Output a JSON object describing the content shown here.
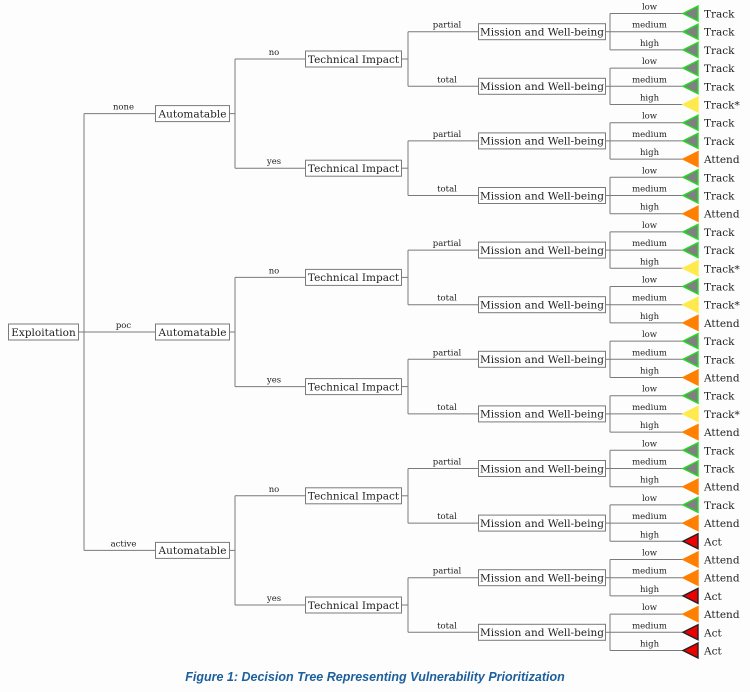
{
  "caption": "Figure 1: Decision Tree Representing Vulnerability Prioritization",
  "colors": {
    "line": "#7a7a7a",
    "Track": "#808080",
    "Track*": "#ffea4d",
    "Attend": "#ff8000",
    "Act": "#ee0000",
    "track_border": "#22dd22",
    "act_border": "#222222"
  },
  "tree": {
    "label": "Exploitation",
    "children": [
      {
        "edge": "none",
        "label": "Automatable",
        "children": [
          {
            "edge": "no",
            "label": "Technical Impact",
            "children": [
              {
                "edge": "partial",
                "label": "Mission and Well-being",
                "children": [
                  {
                    "edge": "low",
                    "leaf": "Track"
                  },
                  {
                    "edge": "medium",
                    "leaf": "Track"
                  },
                  {
                    "edge": "high",
                    "leaf": "Track"
                  }
                ]
              },
              {
                "edge": "total",
                "label": "Mission and Well-being",
                "children": [
                  {
                    "edge": "low",
                    "leaf": "Track"
                  },
                  {
                    "edge": "medium",
                    "leaf": "Track"
                  },
                  {
                    "edge": "high",
                    "leaf": "Track*"
                  }
                ]
              }
            ]
          },
          {
            "edge": "yes",
            "label": "Technical Impact",
            "children": [
              {
                "edge": "partial",
                "label": "Mission and Well-being",
                "children": [
                  {
                    "edge": "low",
                    "leaf": "Track"
                  },
                  {
                    "edge": "medium",
                    "leaf": "Track"
                  },
                  {
                    "edge": "high",
                    "leaf": "Attend"
                  }
                ]
              },
              {
                "edge": "total",
                "label": "Mission and Well-being",
                "children": [
                  {
                    "edge": "low",
                    "leaf": "Track"
                  },
                  {
                    "edge": "medium",
                    "leaf": "Track"
                  },
                  {
                    "edge": "high",
                    "leaf": "Attend"
                  }
                ]
              }
            ]
          }
        ]
      },
      {
        "edge": "poc",
        "label": "Automatable",
        "children": [
          {
            "edge": "no",
            "label": "Technical Impact",
            "children": [
              {
                "edge": "partial",
                "label": "Mission and Well-being",
                "children": [
                  {
                    "edge": "low",
                    "leaf": "Track"
                  },
                  {
                    "edge": "medium",
                    "leaf": "Track"
                  },
                  {
                    "edge": "high",
                    "leaf": "Track*"
                  }
                ]
              },
              {
                "edge": "total",
                "label": "Mission and Well-being",
                "children": [
                  {
                    "edge": "low",
                    "leaf": "Track"
                  },
                  {
                    "edge": "medium",
                    "leaf": "Track*"
                  },
                  {
                    "edge": "high",
                    "leaf": "Attend"
                  }
                ]
              }
            ]
          },
          {
            "edge": "yes",
            "label": "Technical Impact",
            "children": [
              {
                "edge": "partial",
                "label": "Mission and Well-being",
                "children": [
                  {
                    "edge": "low",
                    "leaf": "Track"
                  },
                  {
                    "edge": "medium",
                    "leaf": "Track"
                  },
                  {
                    "edge": "high",
                    "leaf": "Attend"
                  }
                ]
              },
              {
                "edge": "total",
                "label": "Mission and Well-being",
                "children": [
                  {
                    "edge": "low",
                    "leaf": "Track"
                  },
                  {
                    "edge": "medium",
                    "leaf": "Track*"
                  },
                  {
                    "edge": "high",
                    "leaf": "Attend"
                  }
                ]
              }
            ]
          }
        ]
      },
      {
        "edge": "active",
        "label": "Automatable",
        "children": [
          {
            "edge": "no",
            "label": "Technical Impact",
            "children": [
              {
                "edge": "partial",
                "label": "Mission and Well-being",
                "children": [
                  {
                    "edge": "low",
                    "leaf": "Track"
                  },
                  {
                    "edge": "medium",
                    "leaf": "Track"
                  },
                  {
                    "edge": "high",
                    "leaf": "Attend"
                  }
                ]
              },
              {
                "edge": "total",
                "label": "Mission and Well-being",
                "children": [
                  {
                    "edge": "low",
                    "leaf": "Track"
                  },
                  {
                    "edge": "medium",
                    "leaf": "Attend"
                  },
                  {
                    "edge": "high",
                    "leaf": "Act"
                  }
                ]
              }
            ]
          },
          {
            "edge": "yes",
            "label": "Technical Impact",
            "children": [
              {
                "edge": "partial",
                "label": "Mission and Well-being",
                "children": [
                  {
                    "edge": "low",
                    "leaf": "Attend"
                  },
                  {
                    "edge": "medium",
                    "leaf": "Attend"
                  },
                  {
                    "edge": "high",
                    "leaf": "Act"
                  }
                ]
              },
              {
                "edge": "total",
                "label": "Mission and Well-being",
                "children": [
                  {
                    "edge": "low",
                    "leaf": "Attend"
                  },
                  {
                    "edge": "medium",
                    "leaf": "Act"
                  },
                  {
                    "edge": "high",
                    "leaf": "Act"
                  }
                ]
              }
            ]
          }
        ]
      }
    ]
  }
}
